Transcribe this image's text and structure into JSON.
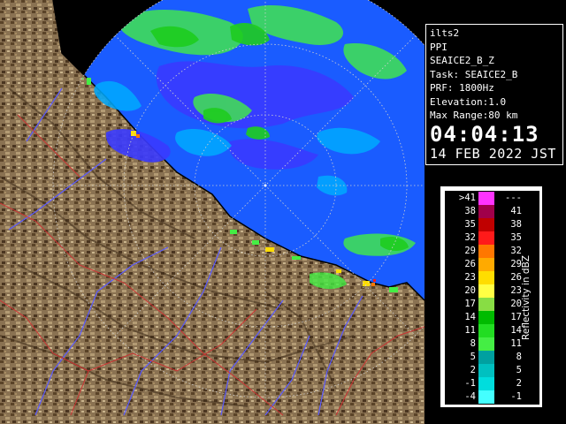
{
  "info": {
    "site": "ilts2",
    "product": "PPI",
    "dataset": "SEAICE2_B_Z",
    "task": "Task: SEAICE2_B",
    "prf": "PRF: 1800Hz",
    "elevation": "Elevation:1.0",
    "max_range": "Max Range:80 km",
    "time": "04:04:13",
    "date": "14 FEB 2022 JST"
  },
  "scale": {
    "unit": "Reflectivity in dBZ",
    "rows": [
      {
        "left": ">41",
        "right": "---",
        "color": "#ff33ff"
      },
      {
        "left": "38",
        "right": "41",
        "color": "#a0004a"
      },
      {
        "left": "35",
        "right": "38",
        "color": "#c00000"
      },
      {
        "left": "32",
        "right": "35",
        "color": "#ff1a1a"
      },
      {
        "left": "29",
        "right": "32",
        "color": "#ff7700"
      },
      {
        "left": "26",
        "right": "29",
        "color": "#ffaa00"
      },
      {
        "left": "23",
        "right": "26",
        "color": "#ffdd00"
      },
      {
        "left": "20",
        "right": "23",
        "color": "#ffff44"
      },
      {
        "left": "17",
        "right": "20",
        "color": "#88dd44"
      },
      {
        "left": "14",
        "right": "17",
        "color": "#00bb00"
      },
      {
        "left": "11",
        "right": "14",
        "color": "#22dd22"
      },
      {
        "left": "8",
        "right": "11",
        "color": "#44ee44"
      },
      {
        "left": "5",
        "right": "8",
        "color": "#00a0a0"
      },
      {
        "left": "2",
        "right": "5",
        "color": "#00c0c0"
      },
      {
        "left": "-1",
        "right": "2",
        "color": "#00dddd"
      },
      {
        "left": "-4",
        "right": "-1",
        "color": "#44ffff"
      }
    ]
  },
  "map": {
    "sea_color": "#1a5cff",
    "outside_color": "#000000",
    "land_color": "#8c7355",
    "river_color": "#5a5aff",
    "boundary_color": "#cc3333",
    "range_ring_color": "#d0d0d0"
  }
}
